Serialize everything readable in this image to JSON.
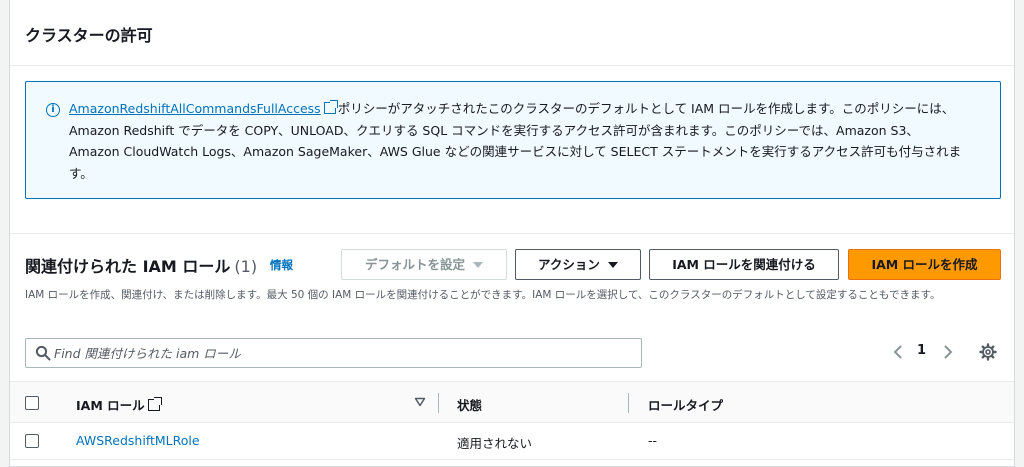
{
  "panel": {
    "title": "クラスターの許可"
  },
  "alert": {
    "policy_link": "AmazonRedshiftAllCommandsFullAccess",
    "text": "ポリシーがアタッチされたこのクラスターのデフォルトとして IAM ロールを作成します。このポリシーには、Amazon Redshift でデータを COPY、UNLOAD、クエリする SQL コマンドを実行するアクセス許可が含まれます。このポリシーでは、Amazon S3、Amazon CloudWatch Logs、Amazon SageMaker、AWS Glue などの関連サービスに対して SELECT ステートメントを実行するアクセス許可も付与されます。"
  },
  "roles_section": {
    "title": "関連付けられた IAM ロール",
    "count": "(1)",
    "info_link": "情報",
    "description": "IAM ロールを作成、関連付け、または削除します。最大 50 個の IAM ロールを関連付けることができます。IAM ロールを選択して、このクラスターのデフォルトとして設定することもできます。",
    "buttons": {
      "set_default": "デフォルトを設定",
      "actions": "アクション",
      "associate": "IAM ロールを関連付ける",
      "create": "IAM ロールを作成"
    },
    "search": {
      "placeholder": "Find 関連付けられた iam ロール",
      "value": ""
    },
    "pagination": {
      "current_page": "1"
    },
    "table": {
      "columns": {
        "role": "IAM ロール",
        "status": "状態",
        "role_type": "ロールタイプ"
      },
      "rows": [
        {
          "role": "AWSRedshiftMLRole",
          "status": "適用されない",
          "role_type": "--"
        }
      ]
    }
  },
  "colors": {
    "link": "#0073bb",
    "primary_button": "#ff9900",
    "info_background": "#f1faff",
    "info_border": "#0073bb"
  },
  "icons": {
    "alert": "info-icon",
    "external": "external-link-icon",
    "search": "search-icon",
    "settings": "gear-icon",
    "prev": "chevron-left-icon",
    "next": "chevron-right-icon",
    "sort": "sort-down-icon"
  }
}
